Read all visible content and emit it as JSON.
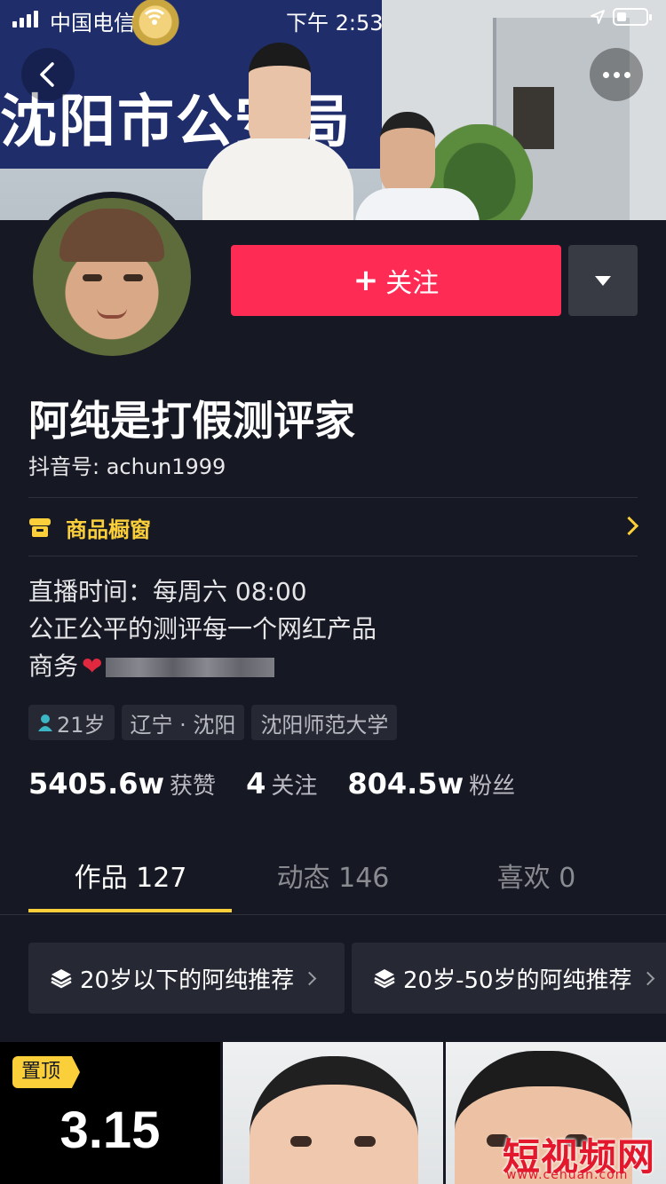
{
  "status_bar": {
    "carrier": "中国电信",
    "time": "下午 2:53"
  },
  "cover": {
    "banner_text": "沈阳市公安局"
  },
  "profile": {
    "follow_label": "关注",
    "name": "阿纯是打假测评家",
    "douyin_id": "抖音号: achun1999",
    "shop_window_label": "商品橱窗",
    "bio_lines": [
      "直播时间：每周六 08:00",
      "公正公平的测评每一个网红产品",
      "商务"
    ],
    "tags": {
      "age": "21岁",
      "location": "辽宁 · 沈阳",
      "school": "沈阳师范大学"
    },
    "stats": {
      "likes_value": "5405.6w",
      "likes_label": "获赞",
      "following_value": "4",
      "following_label": "关注",
      "followers_value": "804.5w",
      "followers_label": "粉丝"
    }
  },
  "tabs": [
    {
      "label": "作品 127",
      "active": true
    },
    {
      "label": "动态 146",
      "active": false
    },
    {
      "label": "喜欢 0",
      "active": false
    }
  ],
  "recommendations": [
    {
      "label": "20岁以下的阿纯推荐"
    },
    {
      "label": "20岁-50岁的阿纯推荐"
    }
  ],
  "videos": [
    {
      "pin_label": "置顶",
      "cover_text": "3.15"
    },
    {
      "cover_text": ""
    },
    {
      "cover_text": ""
    }
  ],
  "watermark": {
    "text": "短视频网",
    "url": "www.cehuan.com"
  },
  "colors": {
    "background": "#161823",
    "follow_button": "#fe2c55",
    "accent_yellow": "#facf3a"
  }
}
